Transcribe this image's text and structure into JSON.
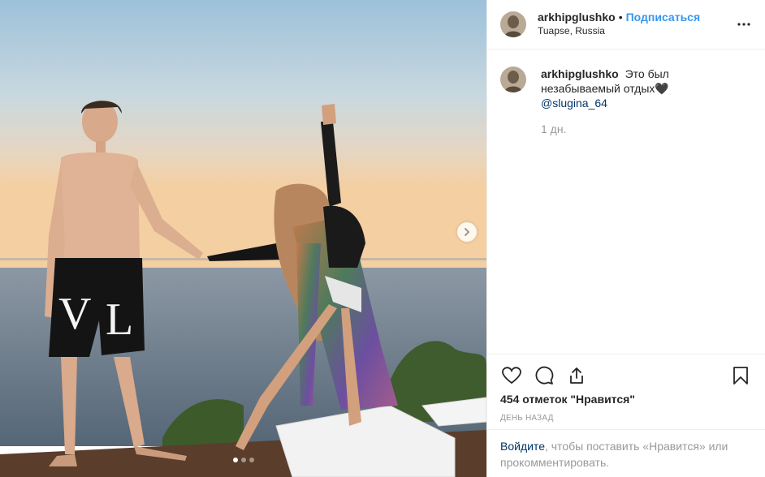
{
  "post": {
    "username": "arkhipglushko",
    "separator": "•",
    "follow_label": "Подписаться",
    "location": "Tuapse, Russia",
    "caption": "Это был незабываемый отдых🖤",
    "mention": "@slugina_64",
    "time_ago": "1 дн.",
    "likes": "454 отметок \"Нравится\"",
    "date_label": "ДЕНЬ НАЗАД",
    "login_link": "Войдите",
    "login_text": ", чтобы поставить «Нравится» или прокомментировать."
  },
  "carousel": {
    "total": 3,
    "current": 1
  },
  "icons": {
    "more": "more-options-icon",
    "like": "heart-icon",
    "comment": "comment-icon",
    "share": "share-icon",
    "save": "bookmark-icon",
    "next": "chevron-right-icon"
  },
  "colors": {
    "link_blue": "#3897f0",
    "mention_blue": "#003569",
    "muted": "#999999"
  }
}
